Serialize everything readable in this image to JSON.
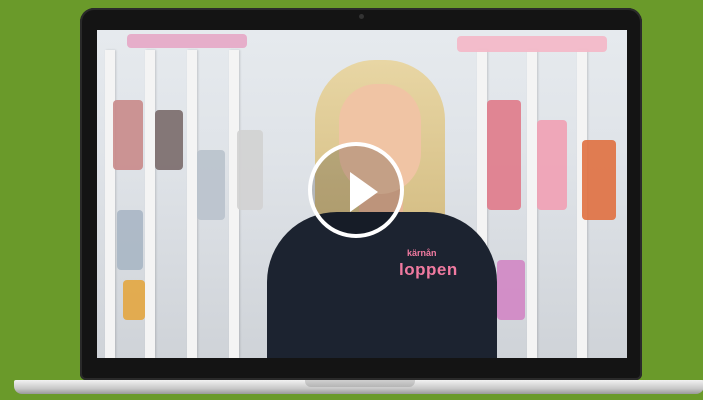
{
  "video": {
    "shirt_text_small": "kärnån",
    "shirt_text_brand": "loppen"
  },
  "controls": {
    "play_icon": "play-icon"
  },
  "colors": {
    "background": "#6a9a2a",
    "laptop_bezel": "#141414",
    "brand_pink": "#f07aa0"
  }
}
